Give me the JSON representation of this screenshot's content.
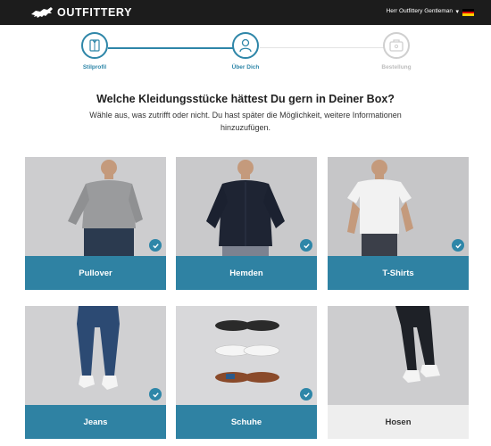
{
  "header": {
    "logo_text": "OUTFITTERY",
    "logo_icon": "panther-icon",
    "user_name": "Herr Outfittery Gentleman",
    "caret_icon": "caret-down-icon",
    "flag_icon": "germany-flag-icon",
    "background": "#1c1c1c"
  },
  "stepper": {
    "accent": "#2e86a8",
    "inactive_color": "#cfcfcf",
    "steps": [
      {
        "label": "Stilprofil",
        "icon": "shirt-icon",
        "state": "done"
      },
      {
        "label": "Über Dich",
        "icon": "user-icon",
        "state": "active"
      },
      {
        "label": "Bestellung",
        "icon": "box-icon",
        "state": "inactive"
      }
    ]
  },
  "main": {
    "title": "Welche Kleidungsstücke hättest Du gern in Deiner Box?",
    "subtitle": "Wähle aus, was zutrifft oder nicht. Du hast später die Möglichkeit, weitere Informationen hinzuzufügen."
  },
  "cards": [
    {
      "label": "Pullover",
      "selected": true,
      "image": "man-in-grey-pullover"
    },
    {
      "label": "Hemden",
      "selected": true,
      "image": "man-in-navy-shirt"
    },
    {
      "label": "T-Shirts",
      "selected": true,
      "image": "man-in-white-tshirt"
    },
    {
      "label": "Jeans",
      "selected": true,
      "image": "legs-in-blue-jeans"
    },
    {
      "label": "Schuhe",
      "selected": true,
      "image": "three-pairs-of-shoes"
    },
    {
      "label": "Hosen",
      "selected": false,
      "image": "legs-in-dark-trousers"
    }
  ],
  "colors": {
    "selected_label_bg": "#2f82a3",
    "unselected_label_bg": "#eeeeee",
    "check_bg": "#2e86a8"
  }
}
